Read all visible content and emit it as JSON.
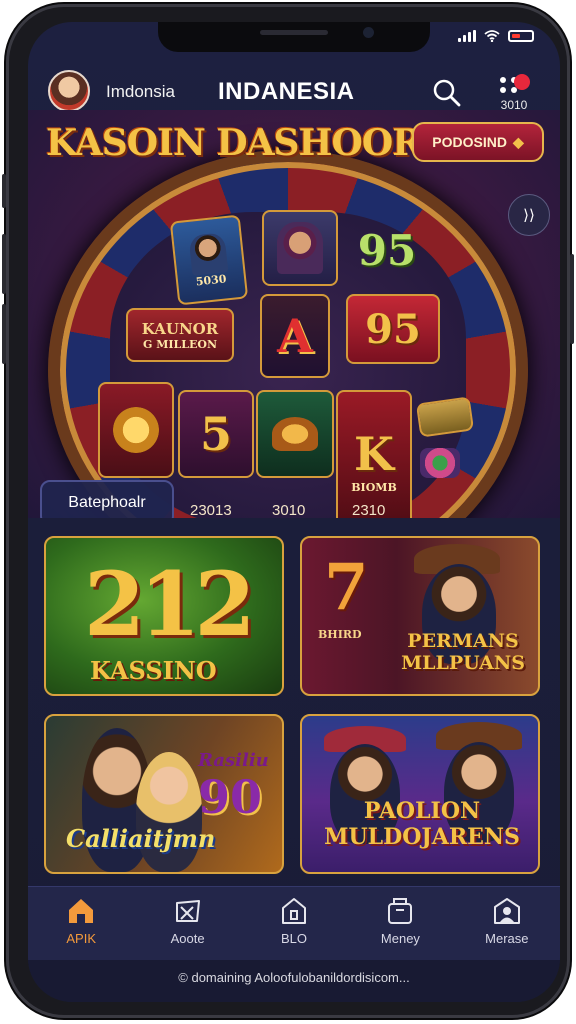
{
  "header": {
    "region_label": "Imdonsia",
    "brand_title": "INDANESIA",
    "notification_count": "3010"
  },
  "hero": {
    "title": "KASOIN DASHOOR",
    "promo_label": "PODOSIND",
    "tile_top_left_label": "5030",
    "tile_center_letter": "A",
    "tile_number_top": "95",
    "tile_number_mid": "95",
    "tile_left_banner": "KAUNOR",
    "tile_left_banner_sub": "G MILLEON",
    "tile_five": "5",
    "tile_k_letter": "K",
    "tile_k_sub": "BIOMB",
    "reel_values": [
      "23013",
      "3010",
      "2310"
    ],
    "label_chip": "Batephoalr"
  },
  "games": [
    {
      "big": "212",
      "title": "KASSINO"
    },
    {
      "big": "7",
      "small": "BHIRD",
      "title": "PERMANS MLLPUANS"
    },
    {
      "script": "Rasiliu",
      "big": "90",
      "title": "Calliaitjmn"
    },
    {
      "title": "PAOLION MULDOJARENS"
    }
  ],
  "nav": {
    "items": [
      {
        "label": "APIK",
        "icon": "home-icon",
        "active": true
      },
      {
        "label": "Aoote",
        "icon": "ticket-icon",
        "active": false
      },
      {
        "label": "BLO",
        "icon": "building-icon",
        "active": false
      },
      {
        "label": "Meney",
        "icon": "wallet-icon",
        "active": false
      },
      {
        "label": "Merase",
        "icon": "profile-icon",
        "active": false
      }
    ]
  },
  "footer": {
    "text": "© domaining Aoloofulobanildordisicom..."
  },
  "colors": {
    "background": "#1d2040",
    "accent": "#f39a3c",
    "gold": "#f2c14a",
    "promo": "#b3243b"
  }
}
